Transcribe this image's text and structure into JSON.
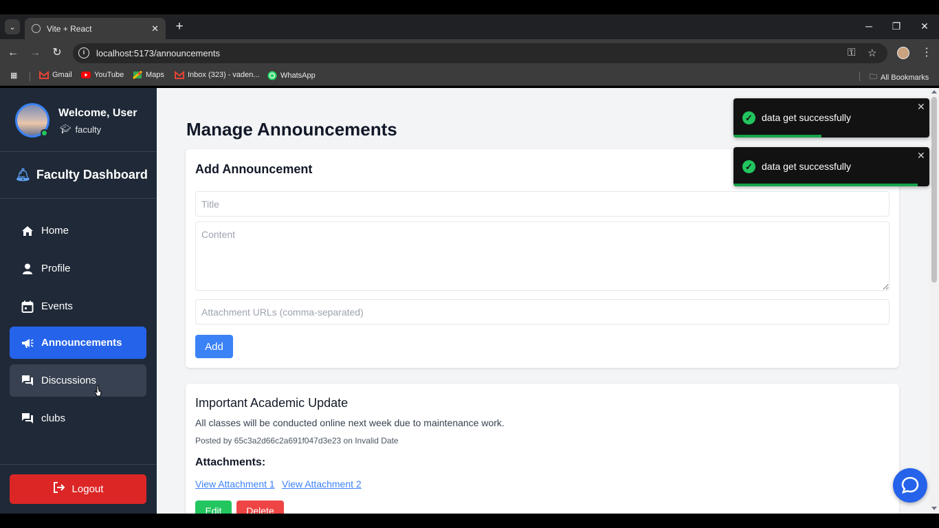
{
  "browser": {
    "tab_title": "Vite + React",
    "url": "localhost:5173/announcements",
    "bookmarks": [
      {
        "label": "Gmail",
        "icon": "gmail-icon"
      },
      {
        "label": "YouTube",
        "icon": "youtube-icon"
      },
      {
        "label": "Maps",
        "icon": "maps-icon"
      },
      {
        "label": "Inbox (323) - vaden...",
        "icon": "gmail-icon"
      },
      {
        "label": "WhatsApp",
        "icon": "whatsapp-icon"
      }
    ],
    "all_bookmarks": "All Bookmarks"
  },
  "sidebar": {
    "welcome": "Welcome, User",
    "role": "faculty",
    "dashboard_title": "Faculty Dashboard",
    "items": [
      {
        "label": "Home",
        "icon": "home-icon"
      },
      {
        "label": "Profile",
        "icon": "user-icon"
      },
      {
        "label": "Events",
        "icon": "calendar-icon"
      },
      {
        "label": "Announcements",
        "icon": "megaphone-icon",
        "active": true
      },
      {
        "label": "Discussions",
        "icon": "chat-icon",
        "hover": true
      },
      {
        "label": "clubs",
        "icon": "chat-icon"
      }
    ],
    "logout": "Logout"
  },
  "main": {
    "title": "Manage Announcements",
    "add_form": {
      "heading": "Add Announcement",
      "title_placeholder": "Title",
      "content_placeholder": "Content",
      "attachments_placeholder": "Attachment URLs (comma-separated)",
      "add_label": "Add"
    },
    "announcement": {
      "title": "Important Academic Update",
      "content": "All classes will be conducted online next week due to maintenance work.",
      "meta": "Posted by 65c3a2d66c2a691f047d3e23 on Invalid Date",
      "attachments_heading": "Attachments:",
      "attachments": [
        "View Attachment 1",
        "View Attachment 2"
      ],
      "edit_label": "Edit",
      "delete_label": "Delete"
    }
  },
  "toasts": [
    {
      "message": "data get successfully",
      "progress": 0.45
    },
    {
      "message": "data get successfully",
      "progress": 0.94
    }
  ],
  "colors": {
    "sidebar_bg": "#1f2937",
    "active_nav": "#2563eb",
    "logout": "#dc2626",
    "add_button": "#3b82f6",
    "edit_button": "#22c55e",
    "delete_button": "#ef4444"
  }
}
